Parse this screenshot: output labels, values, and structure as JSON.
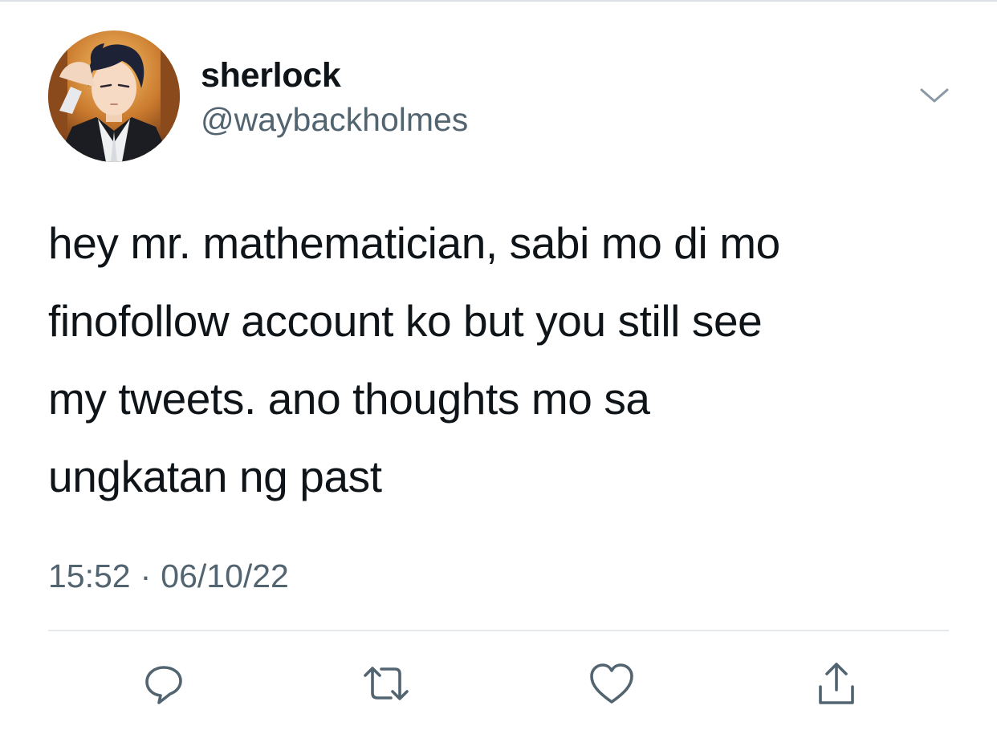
{
  "user": {
    "display_name": "sherlock",
    "handle": "@waybackholmes",
    "avatar_icon": "anime-character-avatar"
  },
  "tweet": {
    "lines": [
      "hey mr. mathematician, sabi mo di mo",
      "finofollow account ko but you still see",
      "my tweets. ano thoughts mo sa",
      "ungkatan ng past"
    ],
    "time": "15:52",
    "separator": "·",
    "date": "06/10/22"
  },
  "actions": {
    "reply_icon": "reply-icon",
    "retweet_icon": "retweet-icon",
    "like_icon": "heart-icon",
    "share_icon": "share-icon",
    "more_icon": "chevron-down-icon"
  },
  "colors": {
    "text_primary": "#0f1419",
    "text_secondary": "#536471",
    "icon_gray": "#536471",
    "divider": "#e6e9ec"
  }
}
